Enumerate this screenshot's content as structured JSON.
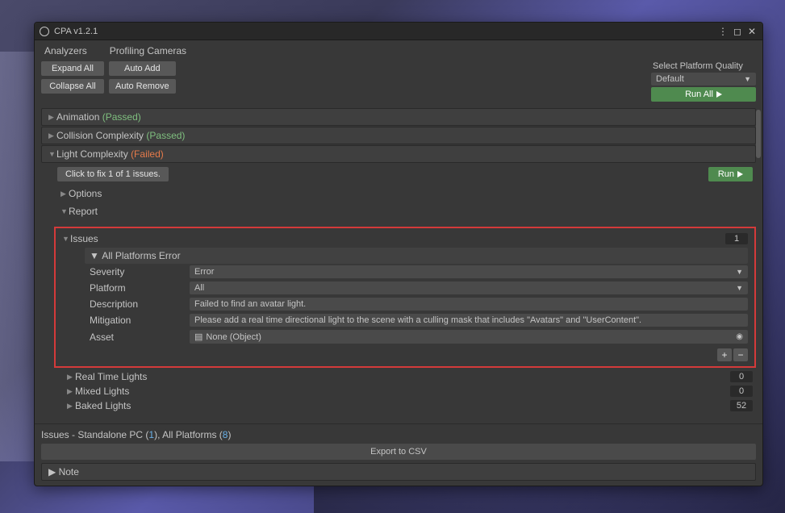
{
  "window": {
    "title": "CPA v1.2.1"
  },
  "tabs": {
    "analyzers": "Analyzers",
    "profiling": "Profiling Cameras"
  },
  "toolbar": {
    "expand_all": "Expand All",
    "collapse_all": "Collapse All",
    "auto_add": "Auto Add",
    "auto_remove": "Auto Remove"
  },
  "platform_quality": {
    "label": "Select Platform Quality",
    "value": "Default",
    "run_all": "Run All"
  },
  "sections": {
    "animation": {
      "name": "Animation",
      "status": "(Passed)"
    },
    "collision": {
      "name": "Collision Complexity",
      "status": "(Passed)"
    },
    "light": {
      "name": "Light Complexity",
      "status": "(Failed)"
    }
  },
  "light_body": {
    "fix_btn": "Click to fix 1 of 1 issues.",
    "run_btn": "Run",
    "options": "Options",
    "report": "Report",
    "issues_label": "Issues",
    "issues_count": "1",
    "error_header": "All Platforms Error",
    "props": {
      "severity_label": "Severity",
      "severity_val": "Error",
      "platform_label": "Platform",
      "platform_val": "All",
      "description_label": "Description",
      "description_val": "Failed to find an avatar light.",
      "mitigation_label": "Mitigation",
      "mitigation_val": "Please add a real time directional light to the scene with a culling mask that includes \"Avatars\" and \"UserContent\".",
      "asset_label": "Asset",
      "asset_val": "None (Object)"
    },
    "rt_lights": {
      "label": "Real Time Lights",
      "count": "0"
    },
    "mixed_lights": {
      "label": "Mixed Lights",
      "count": "0"
    },
    "baked_lights": {
      "label": "Baked Lights",
      "count": "52"
    }
  },
  "footer": {
    "prefix": "Issues - Standalone PC (",
    "standalone_count": "1",
    "mid": "), All Platforms (",
    "all_count": "8",
    "suffix": ")",
    "export": "Export to CSV",
    "note": "Note"
  }
}
